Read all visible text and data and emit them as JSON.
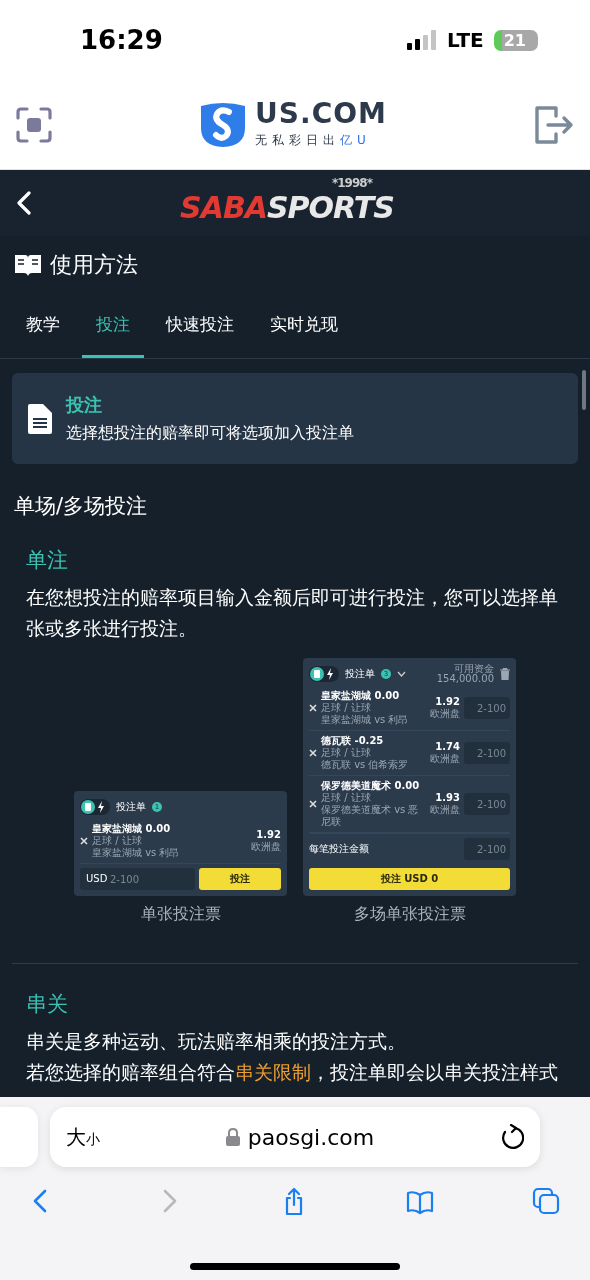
{
  "status_bar": {
    "time": "16:29",
    "network": "LTE",
    "battery": "21"
  },
  "app_header": {
    "brand": "US.COM",
    "slogan": "无私彩日出",
    "slogan_highlight": "亿U"
  },
  "sport_header": {
    "brand_a": "SABA",
    "brand_b": "SPORTS",
    "year": "*1998*"
  },
  "page_title": "使用方法",
  "tabs": [
    {
      "label": "教学",
      "selected": false
    },
    {
      "label": "投注",
      "selected": true
    },
    {
      "label": "快速投注",
      "selected": false
    },
    {
      "label": "实时兑现",
      "selected": false
    }
  ],
  "info_card": {
    "title": "投注",
    "text": "选择想投注的赔率即可将选项加入投注单"
  },
  "section_heading": "单场/多场投注",
  "single": {
    "title": "单注",
    "text": "在您想投注的赔率项目输入金额后即可进行投注，您可以选择单张或多张进行投注。"
  },
  "slips": [
    {
      "kind": "single",
      "title": "投注单",
      "count": "1",
      "legs": [
        {
          "team": "皇家盐湖城 0.00",
          "market": "足球 / 让球",
          "match": "皇家盐湖城 vs 利昂",
          "odds": "1.92",
          "odds_type": "欧洲盘"
        }
      ],
      "currency": "USD",
      "placeholder": "2-100",
      "button": "投注",
      "caption": "单张投注票"
    },
    {
      "kind": "multi",
      "title": "投注单",
      "count": "3",
      "balance_label": "可用资金",
      "balance": "154,000.00",
      "legs": [
        {
          "team": "皇家盐湖城 0.00",
          "market": "足球 / 让球",
          "match": "皇家盐湖城 vs 利昂",
          "odds": "1.92",
          "odds_type": "欧洲盘",
          "placeholder": "2-100"
        },
        {
          "team": "德瓦联 -0.25",
          "market": "足球 / 让球",
          "match": "德瓦联 vs 伯希索罗",
          "odds": "1.74",
          "odds_type": "欧洲盘",
          "placeholder": "2-100"
        },
        {
          "team": "保罗德美道魔术 0.00",
          "market": "足球 / 让球",
          "match": "保罗德美道魔术 vs 恶尼联",
          "odds": "1.93",
          "odds_type": "欧洲盘",
          "placeholder": "2-100"
        }
      ],
      "per_bet_label": "每笔投注金额",
      "placeholder": "2-100",
      "button": "投注 USD 0",
      "caption": "多场单张投注票"
    }
  ],
  "parlay": {
    "title": "串关",
    "text": "串关是多种运动、玩法赔率相乘的投注方式。",
    "text2_before": "若您选择的赔率组合符合",
    "text2_link": "串关限制",
    "text2_after": "，投注单即会以串关投注样式"
  },
  "browser": {
    "text_size_big": "大",
    "text_size_small": "小",
    "url": "paosgi.com",
    "toolbar": [
      {
        "kind": "back",
        "disabled": false
      },
      {
        "kind": "forward",
        "disabled": true
      },
      {
        "kind": "share",
        "disabled": false
      },
      {
        "kind": "bookmarks",
        "disabled": false
      },
      {
        "kind": "tabs",
        "disabled": false
      }
    ]
  }
}
